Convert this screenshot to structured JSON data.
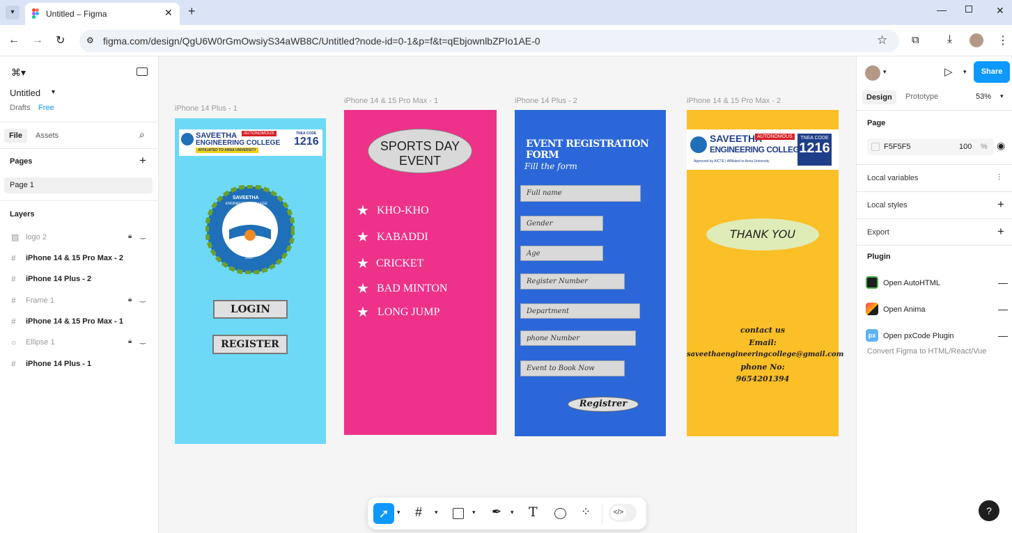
{
  "browser": {
    "tab_title": "Untitled – Figma",
    "url": "figma.com/design/QgU6W0rGmOwsiyS34aWB8C/Untitled?node-id=0-1&p=f&t=qEbjownlbZPIo1AE-0"
  },
  "left": {
    "file_name": "Untitled",
    "drafts": "Drafts",
    "plan": "Free",
    "tabs": [
      "File",
      "Assets"
    ],
    "pages_title": "Pages",
    "page_item": "Page 1",
    "layers_title": "Layers",
    "layers": [
      {
        "name": "logo 2",
        "icon": "image-icon",
        "locked": true,
        "dim": true
      },
      {
        "name": "iPhone 14 & 15 Pro Max - 2",
        "icon": "frame-icon",
        "locked": false,
        "dim": false
      },
      {
        "name": "iPhone 14 Plus - 2",
        "icon": "frame-icon",
        "locked": false,
        "dim": false
      },
      {
        "name": "Frame 1",
        "icon": "frame-icon",
        "locked": true,
        "dim": true
      },
      {
        "name": "iPhone 14 & 15 Pro Max - 1",
        "icon": "frame-icon",
        "locked": false,
        "dim": false
      },
      {
        "name": "Ellipse 1",
        "icon": "ellipse-icon",
        "locked": true,
        "dim": true
      },
      {
        "name": "iPhone 14 Plus - 1",
        "icon": "frame-icon",
        "locked": false,
        "dim": false
      }
    ]
  },
  "frames": {
    "f1": {
      "label": "iPhone 14 Plus - 1",
      "banner_name": "SAVEETHA",
      "banner_name2": "ENGINEERING COLLEGE",
      "banner_autonomous": "AUTONOMOUS",
      "banner_affiliated": "AFFILIATED TO ANNA UNIVERSITY",
      "banner_tnea": "TNEA CODE",
      "banner_code": "1216",
      "seal_top": "SAVEETHA",
      "seal_sub": "ENGINEERING COLLEGE",
      "seal_motto": "BE THE BEST",
      "seal_year": "2001",
      "login": "LOGIN",
      "register": "REGISTER"
    },
    "f2": {
      "label": "iPhone 14 & 15 Pro Max - 1",
      "heading1": "SPORTS DAY",
      "heading2": "EVENT",
      "items": [
        "KHO-KHO",
        "KABADDI",
        "CRICKET",
        "BAD MINTON",
        "LONG JUMP"
      ]
    },
    "f3": {
      "label": "iPhone 14 Plus - 2",
      "title": "EVENT REGISTRATION FORM",
      "subtitle": "Fill the form",
      "fields": [
        "Full name",
        "Gender",
        "Age",
        "Register Number",
        "Department",
        "phone Number",
        "Event to Book Now"
      ],
      "button": "Registrer"
    },
    "f4": {
      "label": "iPhone 14 & 15 Pro Max - 2",
      "banner_name": "SAVEETHA",
      "banner_name2": "ENGINEERING COLLEGE",
      "banner_autonomous": "AUTONOMOUS",
      "banner_approved": "Approved by AICTE | Affiliated to Anna University",
      "banner_tnea": "TNEA CODE",
      "banner_code": "1216",
      "thanks": "THANK YOU",
      "contact1": "contact us",
      "contact2": "Email:",
      "contact3": "saveethaengineeringcollege@gmail.com",
      "contact4": "phone No:",
      "contact5": "9654201394"
    }
  },
  "right": {
    "share": "Share",
    "tabs": [
      "Design",
      "Prototype"
    ],
    "zoom": "53%",
    "page_title": "Page",
    "bg_color": "F5F5F5",
    "bg_opacity": "100",
    "bg_pct": "%",
    "sections": [
      "Local variables",
      "Local styles",
      "Export"
    ],
    "plugin_title": "Plugin",
    "plugins": [
      "Open AutoHTML",
      "Open Anima",
      "Open pxCode Plugin"
    ],
    "plugin_hint": "Convert Figma to HTML/React/Vue"
  },
  "colors": {
    "figma_blue": "#0d99ff",
    "frame1_bg": "#6dd9f7",
    "frame2_bg": "#ee3189",
    "frame3_bg": "#2b67d8",
    "frame4_bg": "#fbbf27"
  }
}
